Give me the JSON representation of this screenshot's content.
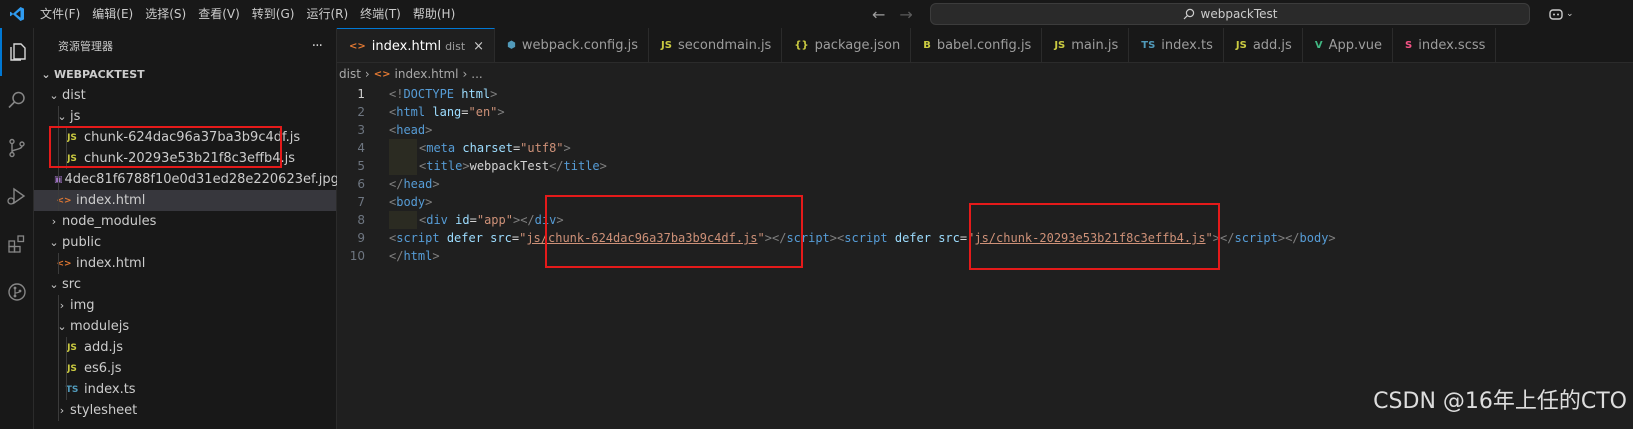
{
  "menus": [
    "文件(F)",
    "编辑(E)",
    "选择(S)",
    "查看(V)",
    "转到(G)",
    "运行(R)",
    "终端(T)",
    "帮助(H)"
  ],
  "search": {
    "text": "webpackTest"
  },
  "explorer": {
    "title": "资源管理器",
    "more": "···",
    "root": "WEBPACKTEST",
    "items": [
      {
        "label": "dist",
        "type": "folder",
        "open": true,
        "depth": 1
      },
      {
        "label": "js",
        "type": "folder",
        "open": true,
        "depth": 2
      },
      {
        "label": "chunk-624dac96a37ba3b9c4df.js",
        "type": "js",
        "depth": 3
      },
      {
        "label": "chunk-20293e53b21f8c3effb4.js",
        "type": "js",
        "depth": 3
      },
      {
        "label": "4dec81f6788f10e0d31ed28e220623ef.jpg",
        "type": "img",
        "depth": 2
      },
      {
        "label": "index.html",
        "type": "html",
        "depth": 2,
        "selected": true
      },
      {
        "label": "node_modules",
        "type": "folder",
        "open": false,
        "depth": 1
      },
      {
        "label": "public",
        "type": "folder",
        "open": true,
        "depth": 1
      },
      {
        "label": "index.html",
        "type": "html",
        "depth": 2
      },
      {
        "label": "src",
        "type": "folder",
        "open": true,
        "depth": 1
      },
      {
        "label": "img",
        "type": "folder",
        "open": false,
        "depth": 2
      },
      {
        "label": "modulejs",
        "type": "folder",
        "open": true,
        "depth": 2
      },
      {
        "label": "add.js",
        "type": "js",
        "depth": 3
      },
      {
        "label": "es6.js",
        "type": "js",
        "depth": 3
      },
      {
        "label": "index.ts",
        "type": "ts",
        "depth": 3
      },
      {
        "label": "stylesheet",
        "type": "folder",
        "open": false,
        "depth": 2
      }
    ]
  },
  "tabs": [
    {
      "label": "index.html",
      "desc": "dist",
      "icon": "<>",
      "kind": "html",
      "active": true,
      "close": "×"
    },
    {
      "label": "webpack.config.js",
      "icon": "⬢",
      "kind": "webpack"
    },
    {
      "label": "secondmain.js",
      "icon": "JS",
      "kind": "js"
    },
    {
      "label": "package.json",
      "icon": "{}",
      "kind": "json"
    },
    {
      "label": "babel.config.js",
      "icon": "B",
      "kind": "babel"
    },
    {
      "label": "main.js",
      "icon": "JS",
      "kind": "js"
    },
    {
      "label": "index.ts",
      "icon": "TS",
      "kind": "ts"
    },
    {
      "label": "add.js",
      "icon": "JS",
      "kind": "js"
    },
    {
      "label": "App.vue",
      "icon": "V",
      "kind": "vue"
    },
    {
      "label": "index.scss",
      "icon": "S",
      "kind": "scss"
    }
  ],
  "breadcrumb": {
    "folder": "dist",
    "file": "index.html",
    "more": "..."
  },
  "code": {
    "line_numbers": [
      "1",
      "2",
      "3",
      "4",
      "5",
      "6",
      "7",
      "8",
      "9",
      "10"
    ],
    "current_line": "1",
    "l1": {
      "a": "<!",
      "b": "DOCTYPE",
      "c": " html",
      "d": ">"
    },
    "l2": {
      "a": "<",
      "b": "html",
      "c": " lang",
      "d": "=",
      "e": "\"en\"",
      "f": ">"
    },
    "l3": {
      "a": "<",
      "b": "head",
      "c": ">"
    },
    "l4": {
      "a": "<",
      "b": "meta",
      "c": " charset",
      "d": "=",
      "e": "\"utf8\"",
      "f": ">"
    },
    "l5": {
      "a": "<",
      "b": "title",
      "c": ">",
      "d": "webpackTest",
      "e": "</",
      "f": "title",
      "g": ">"
    },
    "l6": {
      "a": "</",
      "b": "head",
      "c": ">"
    },
    "l7": {
      "a": "<",
      "b": "body",
      "c": ">"
    },
    "l8": {
      "a": "<",
      "b": "div",
      "c": " id",
      "d": "=",
      "e": "\"app\"",
      "f": ">",
      "g": "</",
      "h": "div",
      "i": ">"
    },
    "l9": {
      "a": "<",
      "b": "script",
      "c": " defer",
      "d": " src",
      "e": "=",
      "f": "\"",
      "g": "js/chunk-624dac96a37ba3b9c4df.js",
      "h": "\"",
      "i": ">",
      "j": "</",
      "k": "script",
      "l": ">",
      "m": "<",
      "n": "script",
      "o": " defer",
      "p": " src",
      "q": "=",
      "r": "\"",
      "s": "js/chunk-20293e53b21f8c3effb4.js",
      "t": "\"",
      "u": ">",
      "v": "</",
      "w": "script",
      "x": ">",
      "y": "</",
      "z": "body",
      "z2": ">"
    },
    "l10": {
      "a": "</",
      "b": "html",
      "c": ">"
    }
  },
  "watermark": "CSDN @16年上任的CTO",
  "colors": {
    "accent": "#0078d4",
    "highlight": "#e51a1a"
  }
}
